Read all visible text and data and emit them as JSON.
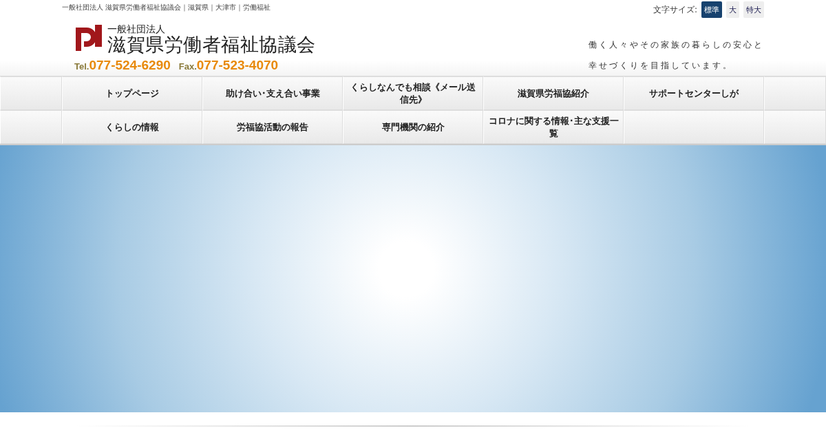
{
  "header_line": "一般社団法人 滋賀県労働者福祉協議会｜滋賀県｜大津市｜労働福祉",
  "font_size": {
    "label": "文字サイズ:",
    "options": [
      {
        "label": "標準",
        "selected": true
      },
      {
        "label": "大",
        "selected": false
      },
      {
        "label": "特大",
        "selected": false
      }
    ]
  },
  "logo": {
    "subtitle": "一般社団法人",
    "name": "滋賀県労働者福祉協議会",
    "tel_label": "Tel.",
    "tel": "077-524-6290",
    "fax_label": "Fax.",
    "fax": "077-523-4070"
  },
  "tagline": [
    "働く人々やその家族の暮らしの安心と",
    "幸せづくりを目指しています。"
  ],
  "nav_rows": [
    [
      "トップページ",
      "助け合い･支え合い事業",
      "くらしなんでも相談《メール送信先》",
      "滋賀県労福協紹介",
      "サポートセンターしが"
    ],
    [
      "くらしの情報",
      "労福協活動の報告",
      "専門機関の紹介",
      "コロナに関する情報･主な支援一覧"
    ]
  ]
}
